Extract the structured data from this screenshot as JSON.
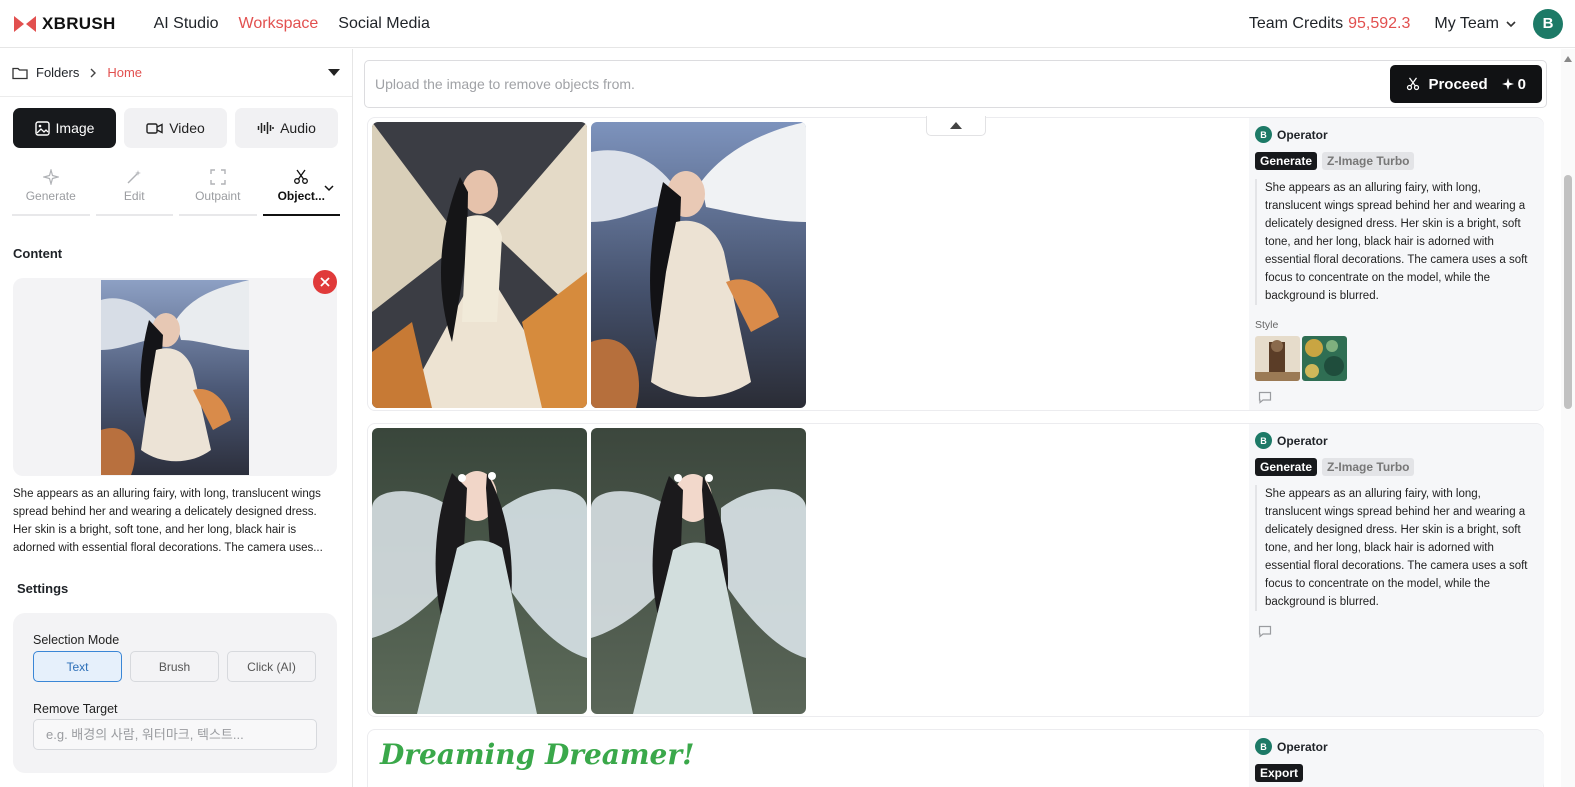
{
  "app": {
    "logo_text": "XBRUSH",
    "brand_color": "#e2504f"
  },
  "nav": {
    "items": [
      {
        "label": "AI Studio",
        "active": false
      },
      {
        "label": "Workspace",
        "active": true
      },
      {
        "label": "Social Media",
        "active": false
      }
    ]
  },
  "header": {
    "credits_label": "Team Credits",
    "credits_value": "95,592.3",
    "team_label": "My Team",
    "avatar_initial": "B"
  },
  "sidebar": {
    "breadcrumb": {
      "root": "Folders",
      "current": "Home"
    },
    "media_tabs": [
      {
        "label": "Image",
        "icon": "image-icon",
        "active": true
      },
      {
        "label": "Video",
        "icon": "video-icon",
        "active": false
      },
      {
        "label": "Audio",
        "icon": "audio-icon",
        "active": false
      }
    ],
    "tool_tabs": [
      {
        "label": "Generate",
        "icon": "sparkle-icon",
        "active": false
      },
      {
        "label": "Edit",
        "icon": "wand-icon",
        "active": false
      },
      {
        "label": "Outpaint",
        "icon": "expand-icon",
        "active": false
      },
      {
        "label": "Object...",
        "icon": "scissors-icon",
        "active": true
      }
    ],
    "content_title": "Content",
    "content_prompt": "She appears as an alluring fairy, with long, translucent wings spread behind her and wearing a delicately designed dress. Her skin is a bright, soft tone, and her long, black hair is adorned with essential floral decorations. The camera uses...",
    "settings_title": "Settings",
    "selection_mode_label": "Selection Mode",
    "selection_modes": [
      {
        "label": "Text",
        "active": true
      },
      {
        "label": "Brush",
        "active": false
      },
      {
        "label": "Click (AI)",
        "active": false
      }
    ],
    "remove_target_label": "Remove Target",
    "remove_target_placeholder": "e.g. 배경의 사람, 워터마크, 텍스트..."
  },
  "main": {
    "upload_placeholder": "Upload the image to remove objects from.",
    "proceed_label": "Proceed",
    "proceed_cost": "0",
    "cards": [
      {
        "operator": "Operator",
        "operator_initial": "B",
        "badge_primary": "Generate",
        "badge_secondary": "Z-Image Turbo",
        "prompt": "She appears as an alluring fairy, with long, translucent wings spread behind her and wearing a delicately designed dress. Her skin is a bright, soft tone, and her long, black hair is adorned with essential floral decorations. The camera uses a soft focus to concentrate on the model, while the background is blurred.",
        "style_label": "Style"
      },
      {
        "operator": "Operator",
        "operator_initial": "B",
        "badge_primary": "Generate",
        "badge_secondary": "Z-Image Turbo",
        "prompt": "She appears as an alluring fairy, with long, translucent wings spread behind her and wearing a delicately designed dress. Her skin is a bright, soft tone, and her long, black hair is adorned with essential floral decorations. The camera uses a soft focus to concentrate on the model, while the background is blurred."
      },
      {
        "operator": "Operator",
        "operator_initial": "B",
        "badge_primary": "Export",
        "image_text": "Dreaming Dreamer!"
      }
    ]
  }
}
